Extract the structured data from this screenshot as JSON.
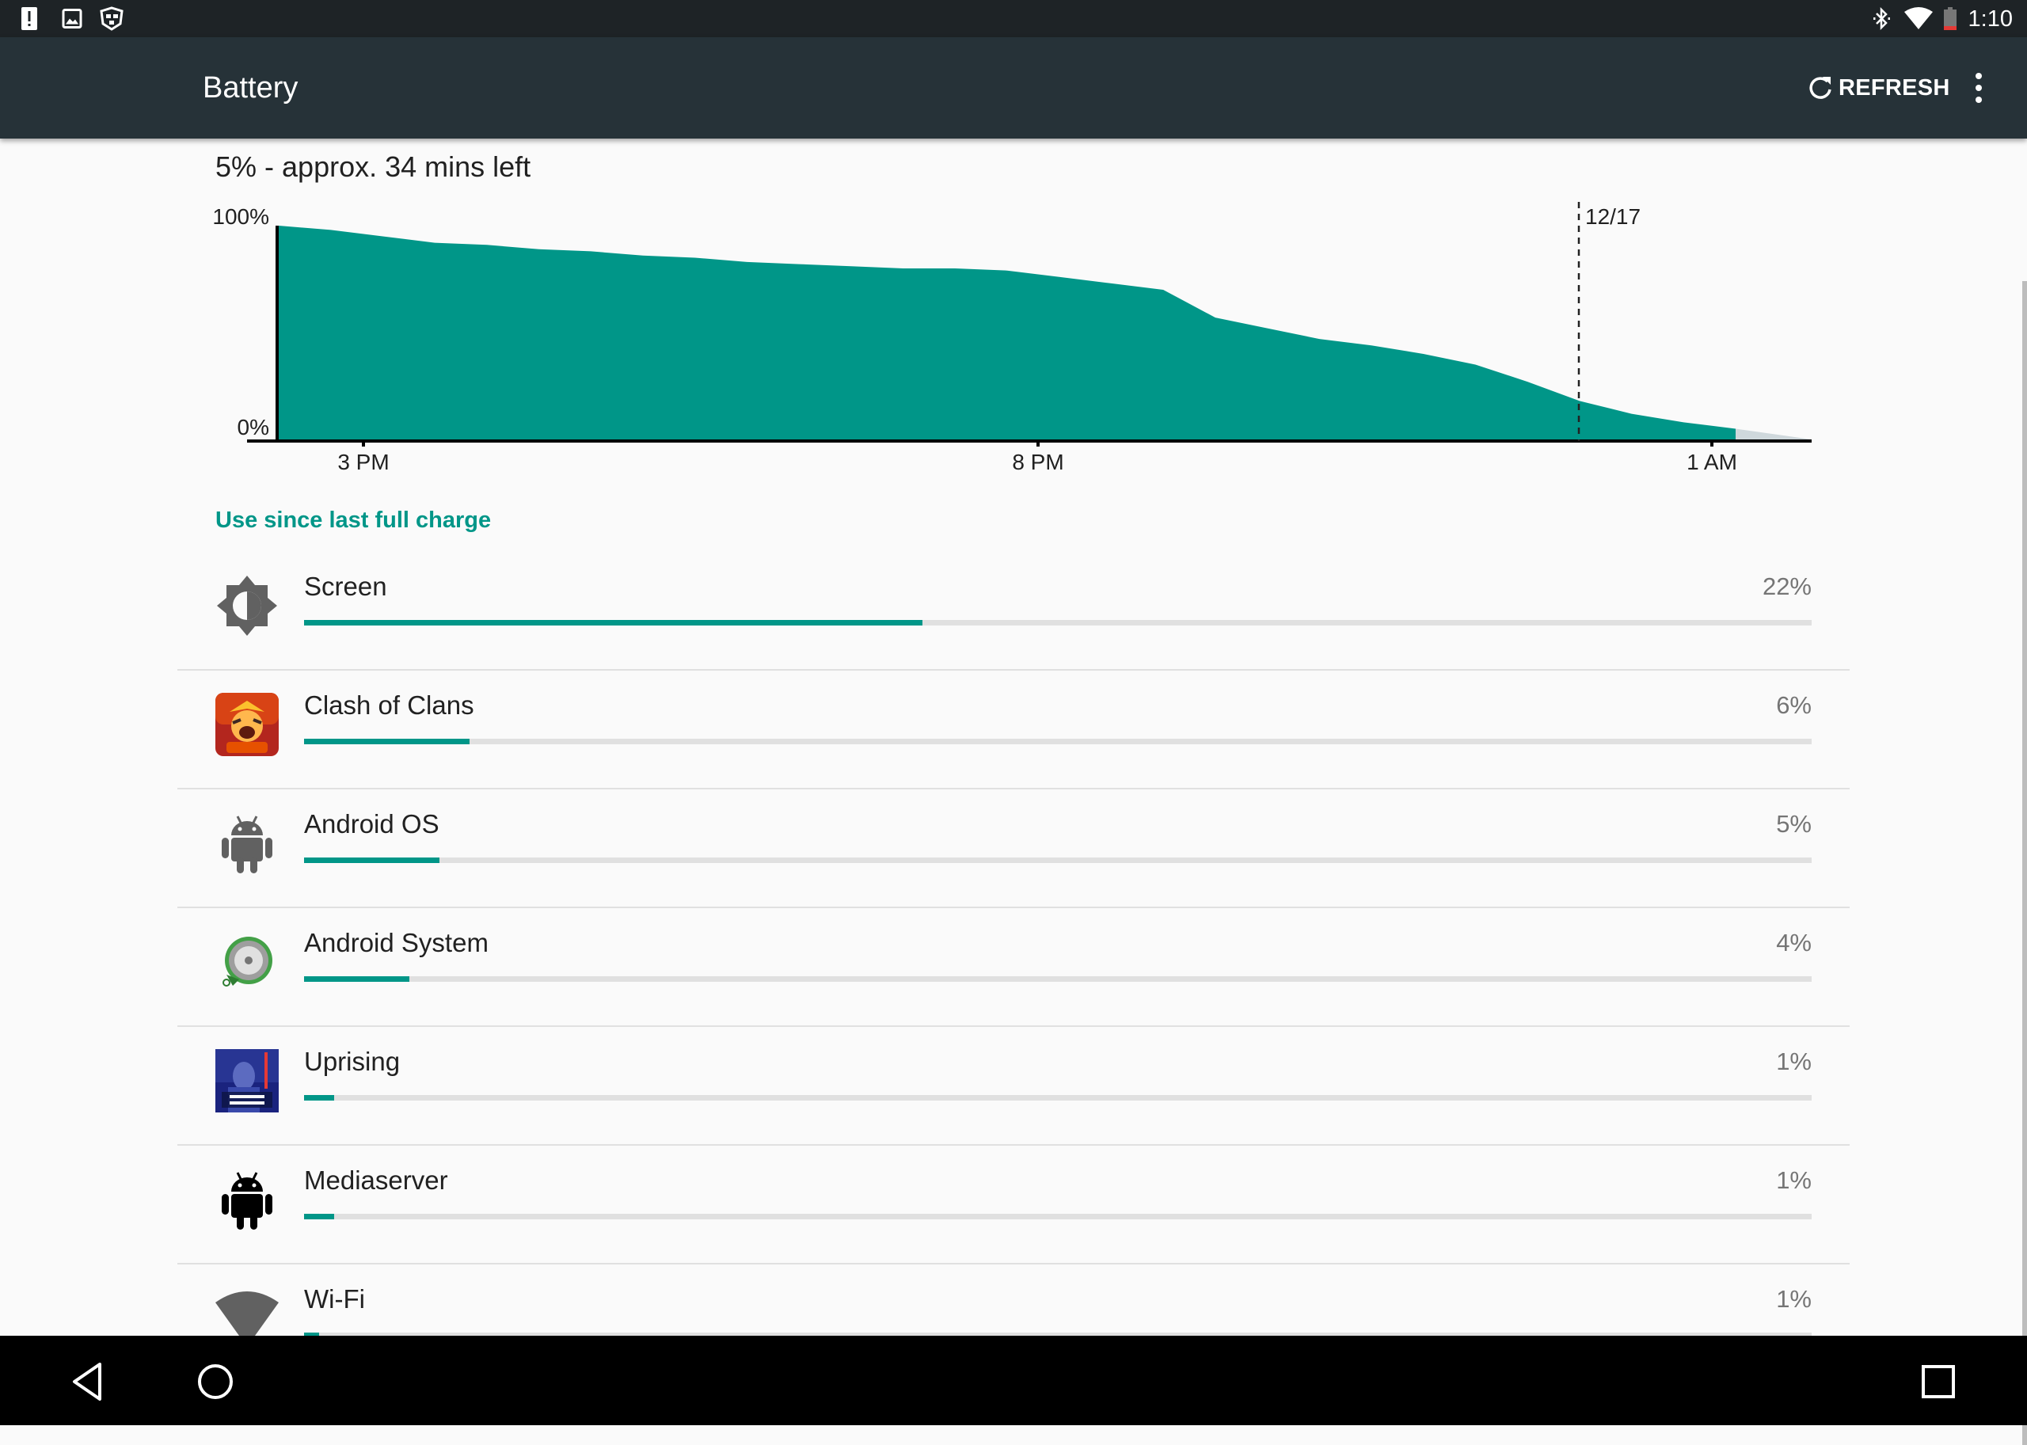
{
  "status_bar": {
    "time": "1:10",
    "left_icons": [
      "alert-notification-icon",
      "image-notification-icon",
      "game-controller-notification-icon"
    ],
    "right_icons": [
      "bluetooth-icon",
      "wifi-signal-icon",
      "battery-low-icon"
    ]
  },
  "app_bar": {
    "title": "Battery",
    "refresh_label": "REFRESH"
  },
  "summary": "5% - approx. 34 mins left",
  "chart": {
    "y_top_label": "100%",
    "y_bottom_label": "0%",
    "date_marker_label": "12/17",
    "x_ticks": [
      "3 PM",
      "8 PM",
      "1 AM"
    ],
    "fill_color": "#009688",
    "prediction_color": "#cfd8dc",
    "battery_percent_trace": [
      100,
      98,
      95,
      92,
      91,
      89,
      88,
      86,
      85,
      83,
      82,
      81,
      80,
      80,
      79,
      76,
      73,
      70,
      57,
      52,
      47,
      44,
      40,
      35,
      27,
      18,
      12,
      8,
      5
    ],
    "projection_end_percent": 0
  },
  "section_header": "Use since last full charge",
  "usage": [
    {
      "name": "Screen",
      "percent_label": "22%",
      "fraction": 0.41,
      "icon": "brightness-icon"
    },
    {
      "name": "Clash of Clans",
      "percent_label": "6%",
      "fraction": 0.11,
      "icon": "clash-of-clans-app-icon"
    },
    {
      "name": "Android OS",
      "percent_label": "5%",
      "fraction": 0.09,
      "icon": "android-robot-icon"
    },
    {
      "name": "Android System",
      "percent_label": "4%",
      "fraction": 0.07,
      "icon": "android-system-icon"
    },
    {
      "name": "Uprising",
      "percent_label": "1%",
      "fraction": 0.02,
      "icon": "uprising-app-icon"
    },
    {
      "name": "Mediaserver",
      "percent_label": "1%",
      "fraction": 0.02,
      "icon": "mediaserver-android-icon"
    },
    {
      "name": "Wi-Fi",
      "percent_label": "1%",
      "fraction": 0.01,
      "icon": "wifi-icon"
    }
  ],
  "nav_bar": {
    "buttons": [
      "back-button",
      "home-button",
      "recents-button"
    ]
  }
}
